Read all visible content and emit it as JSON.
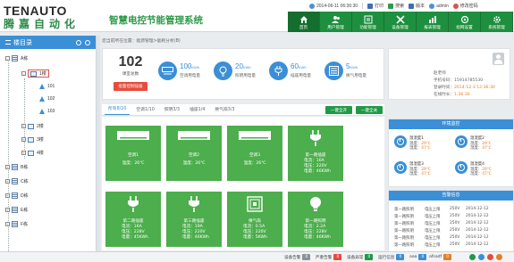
{
  "header": {
    "logo_en": "TENAUTO",
    "logo_cn": "腾嘉自动化",
    "system_title": "智慧电控节能管理系统",
    "datetime": "2014-06-11 06:36:30",
    "links": [
      "打印",
      "搜索",
      "版本",
      "admin",
      "修改密码"
    ],
    "nav": [
      "首页",
      "用户管理",
      "功能管理",
      "设备管理",
      "报表管理",
      "组网设置",
      "系统管理"
    ],
    "colors": {
      "brand_green": "#1e8f3e",
      "accent_blue": "#3b8fd6",
      "alert_red": "#e74c3c"
    }
  },
  "sidebar": {
    "title": "楼目录",
    "items": [
      {
        "label": "A栋"
      },
      {
        "label": "1楼"
      },
      {
        "label": "101"
      },
      {
        "label": "102"
      },
      {
        "label": "103"
      },
      {
        "label": "2楼"
      },
      {
        "label": "3楼"
      },
      {
        "label": "4楼"
      },
      {
        "label": "B栋"
      },
      {
        "label": "C栋"
      },
      {
        "label": "D栋"
      },
      {
        "label": "E栋"
      },
      {
        "label": "F栋"
      }
    ]
  },
  "breadcrumb": "您当前所在位置：能源管理>能耗分析(B)",
  "summary": {
    "count": "102",
    "count_label": "课室总数",
    "button": "批量控制设备",
    "stats": [
      {
        "value": "100",
        "unit": "KWh",
        "label": "空调用电量"
      },
      {
        "value": "20",
        "unit": "KWh",
        "label": "照明用电量"
      },
      {
        "value": "60",
        "unit": "KWh",
        "label": "插座用电量"
      },
      {
        "value": "5",
        "unit": "KWh",
        "label": "换气用电量"
      }
    ]
  },
  "user": {
    "name": "赵老师",
    "phone": "手机号码：15914785530",
    "login_time_label": "登录时间：",
    "login_time": "2014-12-3 12:36:30",
    "online_label": "在线时长：",
    "online": "1:36:30"
  },
  "tabs": [
    "所有8/20",
    "空调1/10",
    "照明3/3",
    "插座1/4",
    "换气扇3/3"
  ],
  "actions": {
    "open_all": "一键全开",
    "close_all": "一键全关"
  },
  "devices": [
    {
      "name": "空调1",
      "lines": [
        "温度：26℃"
      ]
    },
    {
      "name": "空调2",
      "lines": [
        "温度：26℃"
      ]
    },
    {
      "name": "空调3",
      "lines": [
        "温度：26℃"
      ]
    },
    {
      "name": "第一路插座",
      "lines": [
        "电流：16A",
        "电压：220V",
        "电量：46KWh"
      ]
    },
    {
      "name": "第二路插座",
      "lines": [
        "电流：16A",
        "电压：228V",
        "电量：45KWh"
      ]
    },
    {
      "name": "第三路插座",
      "lines": [
        "电流：19A",
        "电压：220V",
        "电量：46KWh"
      ]
    },
    {
      "name": "换气扇",
      "lines": [
        "电流：0.5A",
        "电压：220V",
        "电量：5KWh"
      ]
    },
    {
      "name": "第一路照明",
      "lines": [
        "电流：2.2A",
        "电压：228V",
        "电量：46KWh"
      ]
    }
  ],
  "environment": {
    "title": "环境监控",
    "sensors": [
      {
        "name": "温湿度1",
        "temp": "29℃",
        "hum": "47℃"
      },
      {
        "name": "温湿度2",
        "temp": "29℃",
        "hum": "47℃"
      },
      {
        "name": "温湿度3",
        "temp": "29℃",
        "hum": "47℃"
      },
      {
        "name": "温湿度4",
        "temp": "29℃",
        "hum": "47℃"
      }
    ],
    "temp_label": "温度：",
    "hum_label": "湿度："
  },
  "alarms": {
    "title": "告警信息",
    "rows": [
      {
        "name": "第一路照明",
        "type": "电压上限",
        "value": "250V",
        "date": "2014-12-12"
      },
      {
        "name": "第一路照明",
        "type": "电压上限",
        "value": "250V",
        "date": "2014-12-12"
      },
      {
        "name": "第一路照明",
        "type": "电压上限",
        "value": "250V",
        "date": "2014-12-12"
      },
      {
        "name": "第一路照明",
        "type": "电压上限",
        "value": "250V",
        "date": "2014-12-12"
      },
      {
        "name": "第一路照明",
        "type": "电压上限",
        "value": "250V",
        "date": "2014-12-12"
      },
      {
        "name": "第一路照明",
        "type": "电压上限",
        "value": "250V",
        "date": "2014-12-12"
      }
    ]
  },
  "statusbar": {
    "items": [
      {
        "label": "设备告警",
        "count": "0"
      },
      {
        "label": "严重告警",
        "count": "0"
      },
      {
        "label": "设备异常",
        "count": "0"
      },
      {
        "label": "运行信息",
        "count": "0"
      },
      {
        "label": "aaa",
        "count": "0"
      },
      {
        "label": "afsadf",
        "count": "0"
      }
    ]
  }
}
